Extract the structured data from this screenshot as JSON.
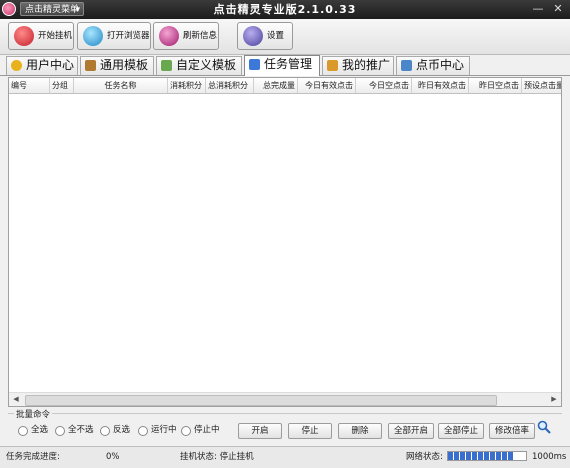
{
  "window": {
    "title": "点击精灵专业版2.1.0.33",
    "menu_button": "点击精灵菜单",
    "minimize_glyph": "—",
    "close_glyph": "✕"
  },
  "toolbar": {
    "buttons": [
      {
        "label": "开始挂机",
        "icon": "start-icon",
        "color": "#d9363e"
      },
      {
        "label": "打开浏览器",
        "icon": "browser-icon",
        "color": "#2a9bd8"
      },
      {
        "label": "刷新信息",
        "icon": "refresh-icon",
        "color": "#b3257a"
      },
      {
        "label": "设置",
        "icon": "settings-icon",
        "color": "#5a4fa8"
      }
    ]
  },
  "tabs": [
    {
      "label": "用户中心",
      "icon": "star-icon",
      "color": "#e8b21c"
    },
    {
      "label": "通用模板",
      "icon": "wand-icon",
      "color": "#b07a30"
    },
    {
      "label": "自定义模板",
      "icon": "template-icon",
      "color": "#6aa84f"
    },
    {
      "label": "任务管理",
      "icon": "task-icon",
      "color": "#3c78d8",
      "active": true
    },
    {
      "label": "我的推广",
      "icon": "promo-icon",
      "color": "#d99a2b"
    },
    {
      "label": "点币中心",
      "icon": "cart-icon",
      "color": "#4a86c8"
    }
  ],
  "table": {
    "columns": [
      "编号",
      "分组",
      "任务名称",
      "消耗积分",
      "总消耗积分",
      "总完成量",
      "今日有效点击",
      "今日空点击",
      "昨日有效点击",
      "昨日空点击",
      "预设点击量"
    ],
    "rows": []
  },
  "commands": {
    "group_label": "批量命令",
    "filters": [
      "全选",
      "全不选",
      "反选",
      "运行中",
      "停止中"
    ],
    "buttons": [
      "开启",
      "停止",
      "删除",
      "全部开启",
      "全部停止",
      "修改倍率"
    ]
  },
  "status": {
    "progress_label": "任务完成进度:",
    "progress_value": "0%",
    "hang_status": "挂机状态: 停止挂机",
    "network_label": "网络状态:",
    "network_latency": "1000ms",
    "network_level": 0.85
  }
}
